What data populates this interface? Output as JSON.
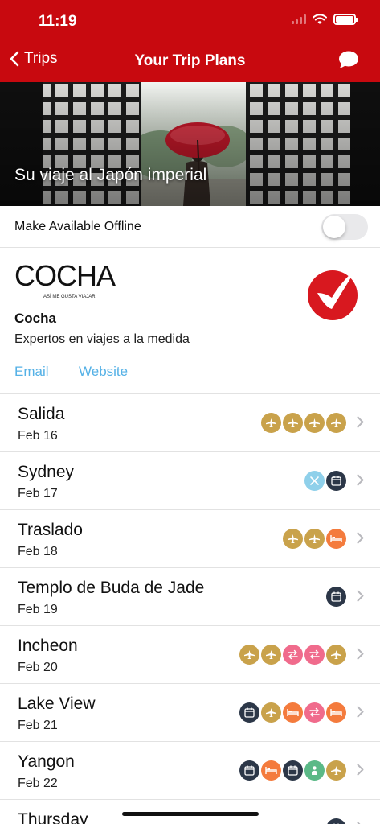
{
  "status_bar": {
    "time": "11:19"
  },
  "nav": {
    "back_label": "Trips",
    "title": "Your Trip Plans"
  },
  "hero": {
    "title": "Su viaje al Japón imperial"
  },
  "offline": {
    "label": "Make Available Offline",
    "enabled": false
  },
  "agency": {
    "logo_text": "COCHA",
    "logo_tagline": "ASÍ ME GUSTA VIAJAR",
    "name": "Cocha",
    "description": "Expertos en viajes a la medida",
    "email_label": "Email",
    "website_label": "Website",
    "brand_color": "#d8181f"
  },
  "colors": {
    "header": "#c8090f",
    "link": "#55b1e6",
    "flight": "#c9a24b",
    "transfer": "#f06b8c",
    "hotel": "#f47b3d",
    "event": "#2c3748",
    "tool": "#8fd0ea",
    "activity": "#5bb987"
  },
  "trips": [
    {
      "title": "Salida",
      "date": "Feb 16",
      "icons": [
        "flight-icon",
        "flight-icon",
        "flight-icon",
        "flight-icon"
      ]
    },
    {
      "title": "Sydney",
      "date": "Feb 17",
      "icons": [
        "tools-icon",
        "calendar-icon"
      ]
    },
    {
      "title": "Traslado",
      "date": "Feb 18",
      "icons": [
        "flight-icon",
        "flight-icon",
        "hotel-icon"
      ]
    },
    {
      "title": "Templo de Buda de Jade",
      "date": "Feb 19",
      "icons": [
        "calendar-icon"
      ]
    },
    {
      "title": "Incheon",
      "date": "Feb 20",
      "icons": [
        "flight-icon",
        "flight-icon",
        "transfer-icon",
        "transfer-icon",
        "flight-icon"
      ]
    },
    {
      "title": "Lake View",
      "date": "Feb 21",
      "icons": [
        "calendar-icon",
        "flight-icon",
        "hotel-icon",
        "transfer-icon",
        "hotel-icon"
      ]
    },
    {
      "title": "Yangon",
      "date": "Feb 22",
      "icons": [
        "calendar-icon",
        "hotel-icon",
        "calendar-icon",
        "activity-icon",
        "flight-icon"
      ]
    },
    {
      "title": "Thursday",
      "date": "",
      "icons": [
        "calendar-icon"
      ]
    }
  ]
}
